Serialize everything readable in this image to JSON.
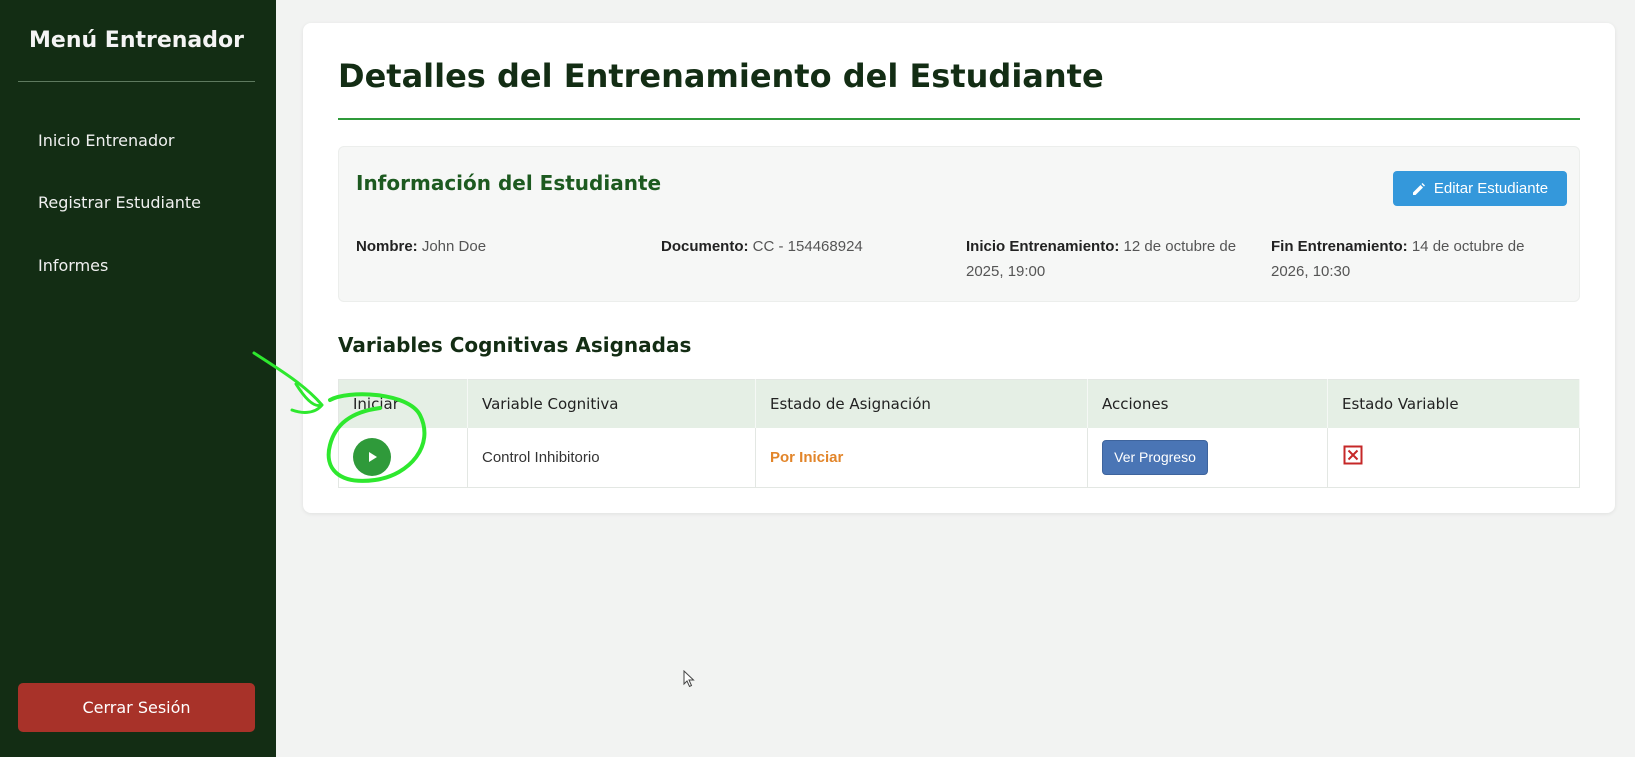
{
  "sidebar": {
    "title": "Menú Entrenador",
    "items": [
      {
        "label": "Inicio Entrenador"
      },
      {
        "label": "Registrar Estudiante"
      },
      {
        "label": "Informes"
      }
    ],
    "logout_label": "Cerrar Sesión"
  },
  "main": {
    "title": "Detalles del Entrenamiento del Estudiante"
  },
  "student_info": {
    "heading": "Información del Estudiante",
    "edit_label": "Editar Estudiante",
    "fields": [
      {
        "label": "Nombre:",
        "value": "John Doe"
      },
      {
        "label": "Documento:",
        "value": "CC - 154468924"
      },
      {
        "label": "Inicio Entrenamiento:",
        "value": "12 de octubre de 2025, 19:00"
      },
      {
        "label": "Fin Entrenamiento:",
        "value": "14 de octubre de 2026, 10:30"
      }
    ]
  },
  "variables": {
    "heading": "Variables Cognitivas Asignadas",
    "columns": [
      "Iniciar",
      "Variable Cognitiva",
      "Estado de Asignación",
      "Acciones",
      "Estado Variable"
    ],
    "rows": [
      {
        "variable": "Control Inhibitorio",
        "status": "Por Iniciar",
        "action_label": "Ver Progreso"
      }
    ]
  },
  "icons": {
    "play": "play-icon",
    "edit": "pencil-icon",
    "variable_state": "x-square-icon"
  },
  "colors": {
    "sidebar_bg": "#132d14",
    "accent_green": "#2f9a3a",
    "logout_red": "#a83229",
    "edit_blue": "#3498db",
    "progress_blue": "#4a75b5",
    "status_orange": "#e2852a",
    "annotation_green": "#2ee82e"
  }
}
